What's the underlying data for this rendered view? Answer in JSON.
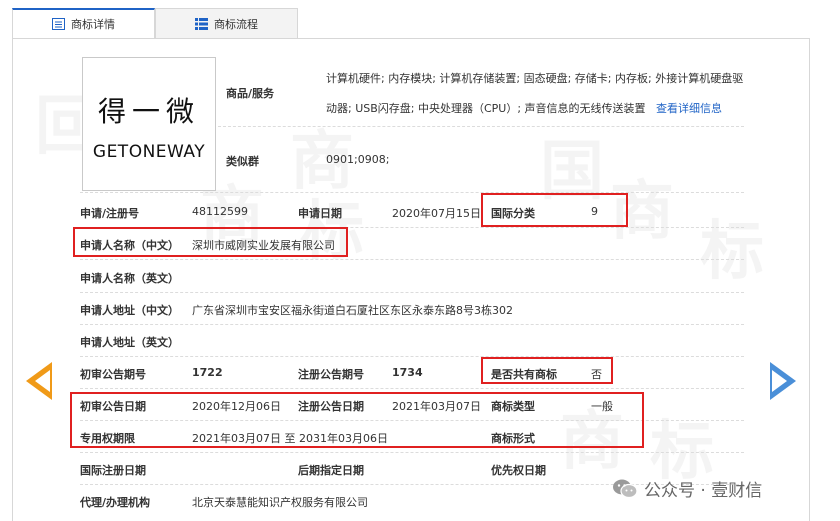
{
  "tabs": [
    {
      "label": "商标详情",
      "active": true
    },
    {
      "label": "商标流程",
      "active": false
    }
  ],
  "logo": {
    "cn": "得一微",
    "en": "GETONEWAY"
  },
  "goods": {
    "label": "商品/服务",
    "line1": "计算机硬件; 内存模块; 计算机存储装置; 固态硬盘; 存储卡; 内存板; 外接计算机硬盘驱",
    "line2": "动器; USB闪存盘; 中央处理器（CPU）; 声音信息的无线传送装置",
    "link": "查看详细信息"
  },
  "similar_group": {
    "label": "类似群",
    "value": "0901;0908;"
  },
  "fields": {
    "reg_no_label": "申请/注册号",
    "reg_no": "48112599",
    "apply_date_label": "申请日期",
    "apply_date": "2020年07月15日",
    "intl_class_label": "国际分类",
    "intl_class": "9",
    "applicant_cn_label": "申请人名称（中文）",
    "applicant_cn": "深圳市威刚实业发展有限公司",
    "applicant_en_label": "申请人名称（英文）",
    "address_cn_label": "申请人地址（中文）",
    "address_cn": "广东省深圳市宝安区福永街道白石厦社区东区永泰东路8号3栋302",
    "address_en_label": "申请人地址（英文）",
    "prelim_no_label": "初审公告期号",
    "prelim_no": "1722",
    "reg_notice_no_label": "注册公告期号",
    "reg_notice_no": "1734",
    "shared_label": "是否共有商标",
    "shared": "否",
    "prelim_date_label": "初审公告日期",
    "prelim_date": "2020年12月06日",
    "reg_notice_date_label": "注册公告日期",
    "reg_notice_date": "2021年03月07日",
    "tm_type_label": "商标类型",
    "tm_type": "一般",
    "term_label": "专用权期限",
    "term": "2021年03月07日 至 2031年03月06日",
    "tm_form_label": "商标形式",
    "intl_reg_date_label": "国际注册日期",
    "later_date_label": "后期指定日期",
    "priority_date_label": "优先权日期",
    "agent_label": "代理/办理机构",
    "agent": "北京天泰慧能知识产权服务有限公司"
  },
  "footer": {
    "wechat": "公众号 · 壹财信"
  },
  "colors": {
    "accent": "#1f63c6",
    "highlight": "#e02020",
    "prev_arrow": "#f09a18",
    "next_arrow": "#4a8fd8"
  }
}
